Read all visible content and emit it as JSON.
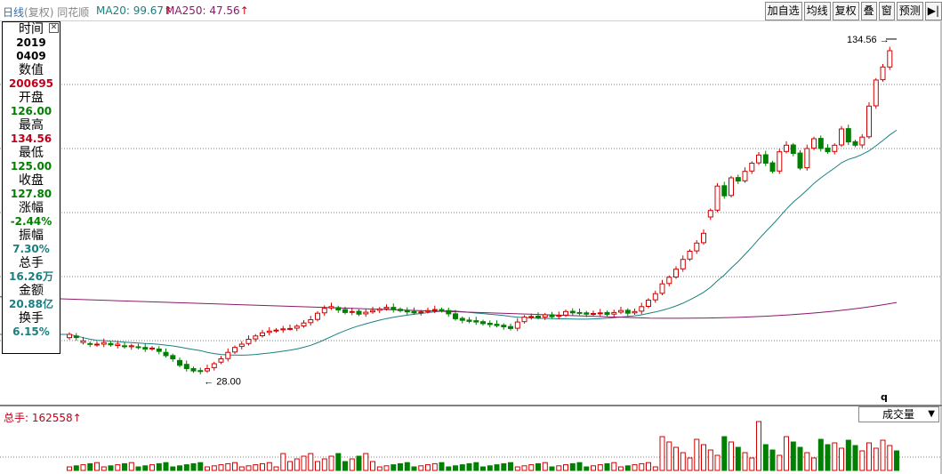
{
  "header": {
    "title_main": "日线",
    "title_sub": "(复权)",
    "source": "同花顺",
    "ma20_label": "MA20: 99.67",
    "ma250_label": "MA250: 47.56",
    "arrow": "↑"
  },
  "toolbar": {
    "buttons": [
      "加自选",
      "均线",
      "复权",
      "叠",
      "窗",
      "预测",
      "▶|"
    ]
  },
  "info_panel": {
    "time_label": "时间",
    "year": "2019",
    "date": "0409",
    "value_label": "数值",
    "value": "200695",
    "open_label": "开盘",
    "open": "126.00",
    "high_label": "最高",
    "high": "134.56",
    "low_label": "最低",
    "low": "125.00",
    "close_label": "收盘",
    "close": "127.80",
    "change_label": "涨幅",
    "change": "-2.44%",
    "amplitude_label": "振幅",
    "amplitude": "7.30%",
    "volume_label": "总手",
    "volume": "16.26万",
    "amount_label": "金额",
    "amount": "20.88亿",
    "turnover_label": "换手",
    "turnover": "6.15%",
    "close_icon": "close-icon"
  },
  "volume_panel": {
    "label": "总手: 162558↑",
    "indicator_select": "成交量",
    "select_arrow": "▼"
  },
  "annotations": {
    "max_label": "134.56",
    "min_label": "28.00",
    "marker": "q"
  },
  "colors": {
    "up": "#d00000",
    "down": "#008000",
    "ma20": "#1a7f7f",
    "ma250": "#8b1a6a",
    "grid": "#808080"
  },
  "chart_data": {
    "type": "candlestick",
    "period": "daily",
    "y_range": [
      20,
      140
    ],
    "grid": "horizontal dashed",
    "highest": 134.56,
    "lowest": 28.0,
    "closes": [
      44,
      43,
      42,
      41,
      41,
      41.5,
      40.8,
      41,
      40.2,
      40.5,
      40,
      39.5,
      39.8,
      38.8,
      37.5,
      36.5,
      34.5,
      33.5,
      32.8,
      32.6,
      33.5,
      35,
      36.5,
      38.5,
      40,
      41,
      42.5,
      43.5,
      44.5,
      45,
      45.3,
      45.7,
      45.8,
      46.5,
      47.5,
      48.5,
      50.5,
      52,
      52.5,
      51.5,
      50.7,
      51,
      50.2,
      50.8,
      51.3,
      51.8,
      52.3,
      51.6,
      51.3,
      50.9,
      50.6,
      50.9,
      51.3,
      51.6,
      51.3,
      50.3,
      48.8,
      48.3,
      48.0,
      47.8,
      47.3,
      47.0,
      46.7,
      46.3,
      45.8,
      47.8,
      49.3,
      49.5,
      49.2,
      50,
      49.4,
      49.8,
      51,
      50.6,
      50.5,
      50.2,
      50.4,
      50.6,
      50.1,
      50.7,
      51.3,
      50.5,
      51,
      52.5,
      54.5,
      56.5,
      59.5,
      61.5,
      64,
      67,
      69.5,
      72,
      75,
      82,
      89.5,
      86.5,
      92,
      91,
      94,
      96.5,
      99,
      96.5,
      94,
      100,
      102,
      99.5,
      95,
      101,
      104,
      101,
      100,
      102,
      107,
      103,
      102,
      104.5,
      114,
      122,
      126,
      131,
      127.8
    ],
    "opens": [
      43,
      43.5,
      41.5,
      41.2,
      40.8,
      41,
      41.2,
      40.6,
      40.5,
      40.2,
      40.2,
      40,
      39.6,
      39.5,
      38.5,
      37.5,
      36,
      34.8,
      33.5,
      32.9,
      32.8,
      33.8,
      35.5,
      36.6,
      38.6,
      40.3,
      41.2,
      42.6,
      43.6,
      44.6,
      45.1,
      45.4,
      45.8,
      45.9,
      46.6,
      47.6,
      48.6,
      50.6,
      52.1,
      52.2,
      51.6,
      50.8,
      51.1,
      50.3,
      50.9,
      51.4,
      51.9,
      52.3,
      51.7,
      51.4,
      51,
      50.7,
      51,
      51.4,
      51.6,
      51.3,
      50.3,
      48.9,
      48.4,
      48.2,
      47.9,
      47.4,
      47.1,
      46.8,
      46.4,
      45.9,
      47.9,
      49.4,
      49.6,
      49.3,
      50,
      49.5,
      49.9,
      51.1,
      50.7,
      50.6,
      50.3,
      50.5,
      50.7,
      50.2,
      50.8,
      51.4,
      50.6,
      51.1,
      52.6,
      54.6,
      56.6,
      59.6,
      61.6,
      64.1,
      67.1,
      69.6,
      72.1,
      80,
      82.1,
      89.6,
      86.6,
      92.1,
      91.1,
      94.1,
      96.6,
      99.1,
      96.6,
      94.1,
      100.1,
      102.1,
      99.6,
      95.1,
      101.1,
      104.1,
      101.1,
      100.1,
      102.1,
      107.1,
      103.1,
      102.1,
      104.6,
      114.1,
      122.1,
      126
    ]
  }
}
